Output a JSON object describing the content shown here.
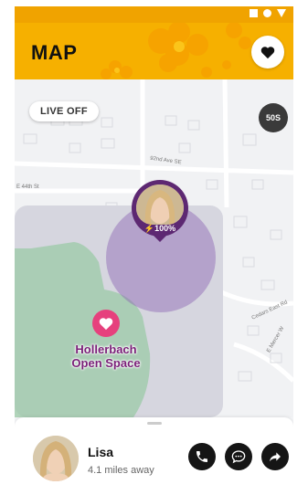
{
  "header": {
    "title": "MAP"
  },
  "map": {
    "live_toggle": "LIVE OFF",
    "timer": "50S",
    "streets": [
      "92nd Ave SE",
      "E 44th St",
      "Cedars East Rd",
      "E Mercer W"
    ],
    "place": {
      "name_line1": "Hollerbach",
      "name_line2": "Open Space"
    },
    "avatar_pin": {
      "battery": "⚡100%"
    }
  },
  "contact": {
    "name": "Lisa",
    "distance": "4.1 miles away"
  },
  "colors": {
    "accent": "#f6b000",
    "pin_purple": "#5d2872",
    "place_pink": "#e6417d",
    "label_purple": "#7a1f78"
  },
  "icons": [
    "heart-icon",
    "phone-icon",
    "chat-icon",
    "share-arrow-icon"
  ]
}
